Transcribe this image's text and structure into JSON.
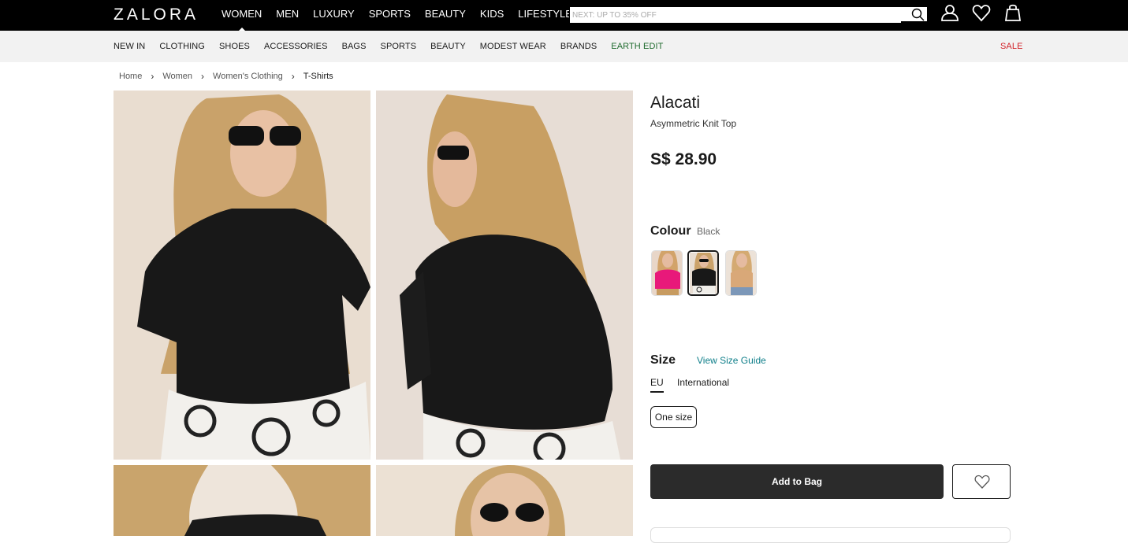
{
  "header": {
    "logo": "ZALORA",
    "nav": [
      "WOMEN",
      "MEN",
      "LUXURY",
      "SPORTS",
      "BEAUTY",
      "KIDS",
      "LIFESTYLE"
    ],
    "active_nav": "WOMEN",
    "search_placeholder": "NEXT: UP TO 35% OFF",
    "icons": [
      "account-icon",
      "wishlist-icon",
      "bag-icon"
    ]
  },
  "categories": {
    "items": [
      "NEW IN",
      "CLOTHING",
      "SHOES",
      "ACCESSORIES",
      "BAGS",
      "SPORTS",
      "BEAUTY",
      "MODEST WEAR",
      "BRANDS",
      "EARTH EDIT"
    ],
    "sale": "SALE"
  },
  "breadcrumb": [
    "Home",
    "Women",
    "Women's Clothing",
    "T-Shirts"
  ],
  "product": {
    "brand": "Alacati",
    "name": "Asymmetric Knit Top",
    "price": "S$ 28.90",
    "colour_label": "Colour",
    "colour_value": "Black",
    "colours": [
      "Pink",
      "Black",
      "Beige"
    ],
    "selected_colour_index": 1,
    "size_label": "Size",
    "size_guide": "View Size Guide",
    "size_tabs": [
      "EU",
      "International"
    ],
    "active_size_tab": "EU",
    "sizes": [
      "One size"
    ],
    "add_to_bag": "Add to Bag"
  },
  "colors": {
    "topbar": "#000000",
    "catbar": "#f2f2f2",
    "sale": "#d2232a",
    "earth_edit": "#1f6b2e",
    "link": "#0f7f8a",
    "button": "#2b2b2b"
  }
}
